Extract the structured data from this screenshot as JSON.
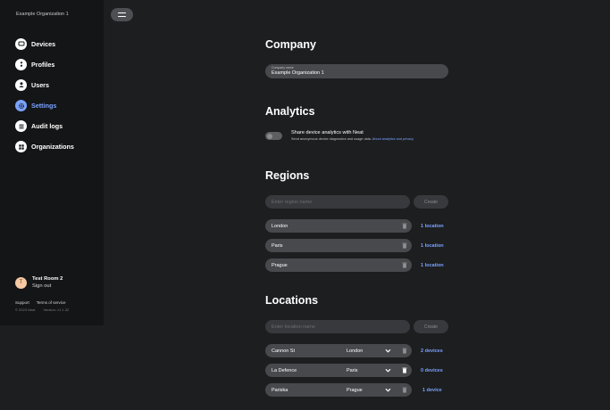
{
  "sidebar": {
    "org_name": "Example Organization 1",
    "nav": [
      {
        "label": "Devices",
        "icon": "devices-icon",
        "active": false
      },
      {
        "label": "Profiles",
        "icon": "profiles-icon",
        "active": false
      },
      {
        "label": "Users",
        "icon": "user-icon",
        "active": false
      },
      {
        "label": "Settings",
        "icon": "settings-icon",
        "active": true
      },
      {
        "label": "Audit logs",
        "icon": "audit-logs-icon",
        "active": false
      },
      {
        "label": "Organizations",
        "icon": "organizations-icon",
        "active": false
      }
    ],
    "profile": {
      "initial": "T",
      "name": "Test Room 2",
      "sign_out": "Sign out"
    },
    "footer": {
      "support": "Support",
      "terms": "Terms of service",
      "copyright": "© 2023 Neat",
      "version": "Version: v1.1.32"
    }
  },
  "colors": {
    "accent": "#7aa2ff",
    "sidebar_bg": "#141517",
    "page_bg": "#1d1e20",
    "field_bg": "#48494d"
  },
  "company": {
    "title": "Company",
    "field_label": "Company name",
    "field_value": "Example Organization 1"
  },
  "analytics": {
    "title": "Analytics",
    "toggle_on": false,
    "setting_title": "Share device analytics with Neat",
    "setting_desc": "Send anonymous device diagnostics and usage data.",
    "link": "About analytics and privacy"
  },
  "regions": {
    "title": "Regions",
    "input_placeholder": "Enter region name",
    "create_label": "Create",
    "items": [
      {
        "name": "London",
        "count": "1 location"
      },
      {
        "name": "Paris",
        "count": "1 location"
      },
      {
        "name": "Prague",
        "count": "1 location"
      }
    ]
  },
  "locations": {
    "title": "Locations",
    "input_placeholder": "Enter location name",
    "create_label": "Create",
    "items": [
      {
        "name": "Cannon St",
        "region": "London",
        "count": "2 devices"
      },
      {
        "name": "La Defence",
        "region": "Paris",
        "count": "0 devices"
      },
      {
        "name": "Pariska",
        "region": "Prague",
        "count": "1 device"
      }
    ]
  }
}
